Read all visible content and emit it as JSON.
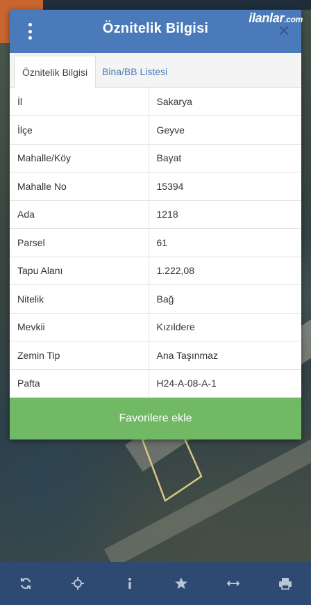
{
  "dialog": {
    "title": "Öznitelik Bilgisi",
    "close_symbol": "✕",
    "watermark": "ilanlar",
    "watermark_suffix": ".com"
  },
  "tabs": [
    {
      "label": "Öznitelik Bilgisi",
      "active": true
    },
    {
      "label": "Bina/BB Listesi",
      "active": false
    }
  ],
  "attributes": [
    {
      "key": "İl",
      "value": "Sakarya"
    },
    {
      "key": "İlçe",
      "value": "Geyve"
    },
    {
      "key": "Mahalle/Köy",
      "value": "Bayat"
    },
    {
      "key": "Mahalle No",
      "value": "15394"
    },
    {
      "key": "Ada",
      "value": "1218"
    },
    {
      "key": "Parsel",
      "value": "61"
    },
    {
      "key": "Tapu Alanı",
      "value": "1.222,08"
    },
    {
      "key": "Nitelik",
      "value": "Bağ"
    },
    {
      "key": "Mevkii",
      "value": "Kızıldere"
    },
    {
      "key": "Zemin Tip",
      "value": "Ana Taşınmaz"
    },
    {
      "key": "Pafta",
      "value": "H24-A-08-A-1"
    }
  ],
  "favorite_button": "Favorilere ekle",
  "toolbar": [
    "refresh-icon",
    "locate-icon",
    "info-icon",
    "star-icon",
    "measure-icon",
    "print-icon"
  ],
  "colors": {
    "header": "#4a7ab9",
    "button": "#71b964",
    "toolbar": "#2f4a72",
    "parcel_outline": "#d8c884"
  }
}
